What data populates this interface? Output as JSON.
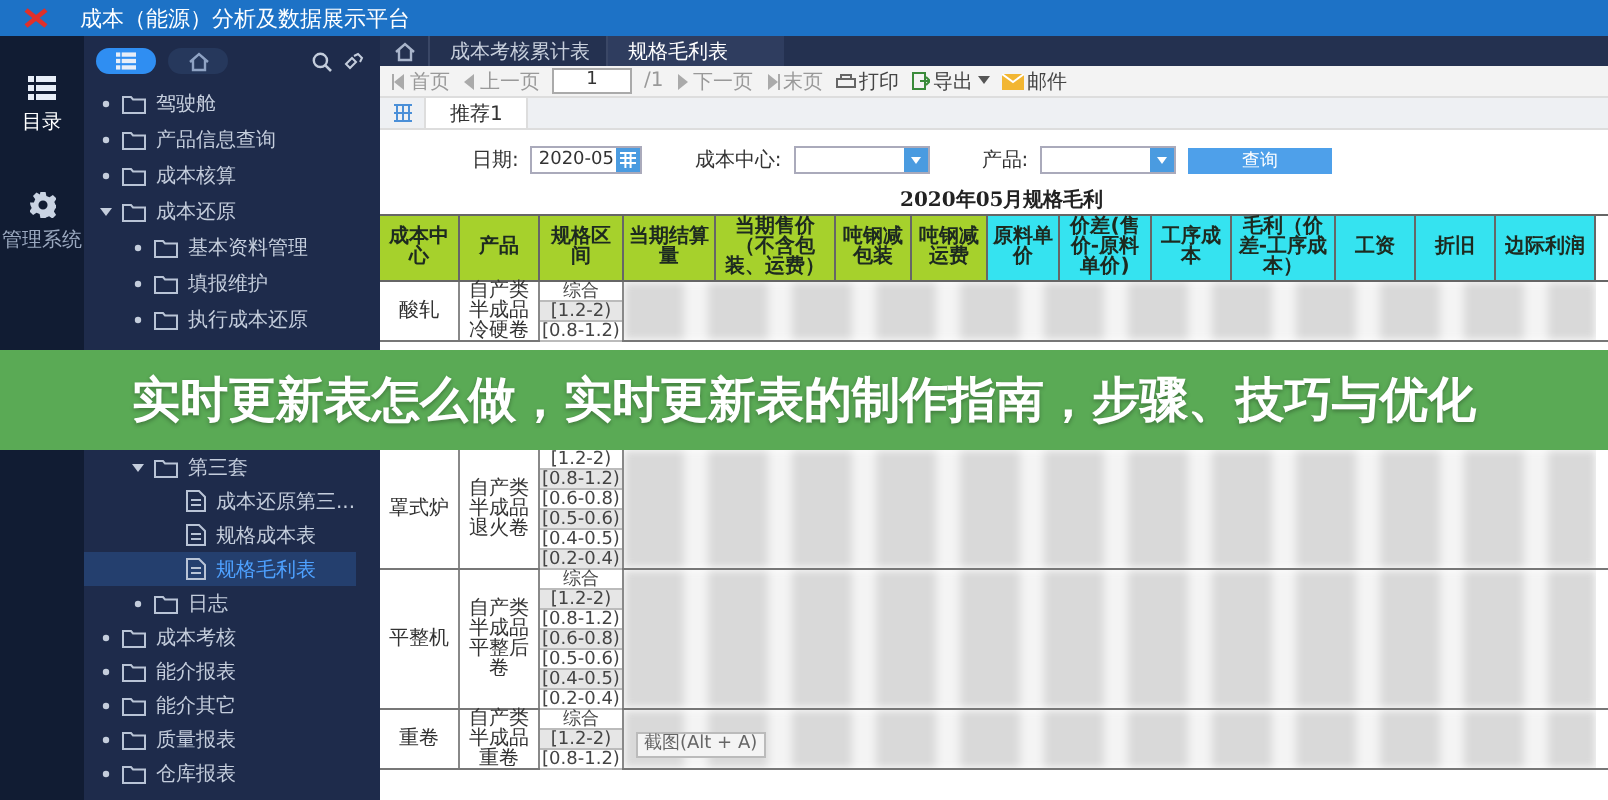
{
  "window": {
    "title": "成本（能源）分析及数据展示平台"
  },
  "rail": [
    {
      "kind": "list",
      "label": "目录",
      "selected": true
    },
    {
      "kind": "gear",
      "label": "管理系统",
      "selected": false
    }
  ],
  "sidebar": {
    "view_toggle": [
      {
        "kind": "list",
        "selected": true
      },
      {
        "kind": "home",
        "selected": false
      }
    ],
    "tree": [
      {
        "kind": "folder",
        "label": "驾驶舱",
        "expanded": false,
        "selected": false
      },
      {
        "kind": "folder",
        "label": "产品信息查询",
        "expanded": false,
        "selected": false
      },
      {
        "kind": "folder",
        "label": "成本核算",
        "expanded": false,
        "selected": false
      },
      {
        "kind": "folder",
        "label": "成本还原",
        "expanded": true,
        "selected": false,
        "children": [
          {
            "kind": "folder",
            "label": "基本资料管理",
            "expanded": false,
            "selected": false
          },
          {
            "kind": "folder",
            "label": "填报维护",
            "expanded": false,
            "selected": false
          },
          {
            "kind": "folder",
            "label": "执行成本还原",
            "expanded": false,
            "selected": false
          }
        ]
      }
    ],
    "tree_continued": {
      "children": [
        {
          "kind": "folder",
          "label": "第三套",
          "expanded": true,
          "selected": false,
          "children": [
            {
              "kind": "file",
              "label": "成本还原第三...",
              "selected": false
            },
            {
              "kind": "file",
              "label": "规格成本表",
              "selected": false
            },
            {
              "kind": "file",
              "label": "规格毛利表",
              "selected": true
            }
          ]
        },
        {
          "kind": "folder",
          "label": "日志",
          "expanded": false,
          "selected": false
        }
      ],
      "items": [
        {
          "kind": "folder",
          "label": "成本考核",
          "expanded": false,
          "selected": false
        },
        {
          "kind": "folder",
          "label": "能介报表",
          "expanded": false,
          "selected": false
        },
        {
          "kind": "folder",
          "label": "能介其它",
          "expanded": false,
          "selected": false
        },
        {
          "kind": "folder",
          "label": "质量报表",
          "expanded": false,
          "selected": false
        },
        {
          "kind": "folder",
          "label": "仓库报表",
          "expanded": false,
          "selected": false
        }
      ]
    }
  },
  "main": {
    "tabs": [
      {
        "label": "成本考核累计表",
        "selected": false
      },
      {
        "label": "规格毛利表",
        "selected": true
      }
    ],
    "toolbar": {
      "first": "首页",
      "prev": "上一页",
      "page": "1",
      "page_total": "/1",
      "next": "下一页",
      "last": "末页",
      "print": "打印",
      "export": "导出",
      "mail": "邮件"
    },
    "report_tab": "推荐1",
    "filters": {
      "date_label": "日期:",
      "date_value": "2020-05",
      "cost_center_label": "成本中心:",
      "product_label": "产品:",
      "query_button": "查询"
    },
    "table": {
      "title": "2020年05月规格毛利",
      "columns": [
        {
          "label": "成本中心",
          "color": "#a6d12c"
        },
        {
          "label": "产品",
          "color": "#a6d12c"
        },
        {
          "label": "规格区间",
          "color": "#a6d12c"
        },
        {
          "label": "当期结算量",
          "color": "#a6d12c"
        },
        {
          "label": "当期售价（不含包装、运费）",
          "color": "#a6d12c"
        },
        {
          "label": "吨钢减包装",
          "color": "#a6d12c"
        },
        {
          "label": "吨钢减运费",
          "color": "#a6d12c"
        },
        {
          "label": "原料单价",
          "color": "#35e3f0"
        },
        {
          "label": "价差(售价-原料单价)",
          "color": "#35e3f0"
        },
        {
          "label": "工序成本",
          "color": "#35e3f0"
        },
        {
          "label": "毛利（价差-工序成本）",
          "color": "#35e3f0"
        },
        {
          "label": "工资",
          "color": "#35e3f0"
        },
        {
          "label": "折旧",
          "color": "#35e3f0"
        },
        {
          "label": "边际利润",
          "color": "#35e3f0"
        }
      ],
      "groups_above_banner": [
        {
          "cost_center": "酸轧",
          "product": "自产类半成品冷硬卷",
          "intervals": [
            "综合",
            "[1.2-2)",
            "[0.8-1.2)"
          ]
        }
      ],
      "groups_below_banner": [
        {
          "cost_center": "罩式炉",
          "product": "自产类半成品退火卷",
          "intervals": [
            "[1.2-2)",
            "[0.8-1.2)",
            "[0.6-0.8)",
            "[0.5-0.6)",
            "[0.4-0.5)",
            "[0.2-0.4)"
          ]
        },
        {
          "cost_center": "平整机",
          "product": "自产类半成品平整后卷",
          "intervals": [
            "综合",
            "[1.2-2)",
            "[0.8-1.2)",
            "[0.6-0.8)",
            "[0.5-0.6)",
            "[0.4-0.5)",
            "[0.2-0.4)"
          ]
        },
        {
          "cost_center": "重卷",
          "product": "自产类半成品重卷",
          "intervals": [
            "综合",
            "[1.2-2)",
            "[0.8-1.2)"
          ]
        }
      ]
    },
    "tooltip": "截图(Alt + A)"
  },
  "banner": {
    "text": "实时更新表怎么做，实时更新表的制作指南，步骤、技巧与优化"
  }
}
